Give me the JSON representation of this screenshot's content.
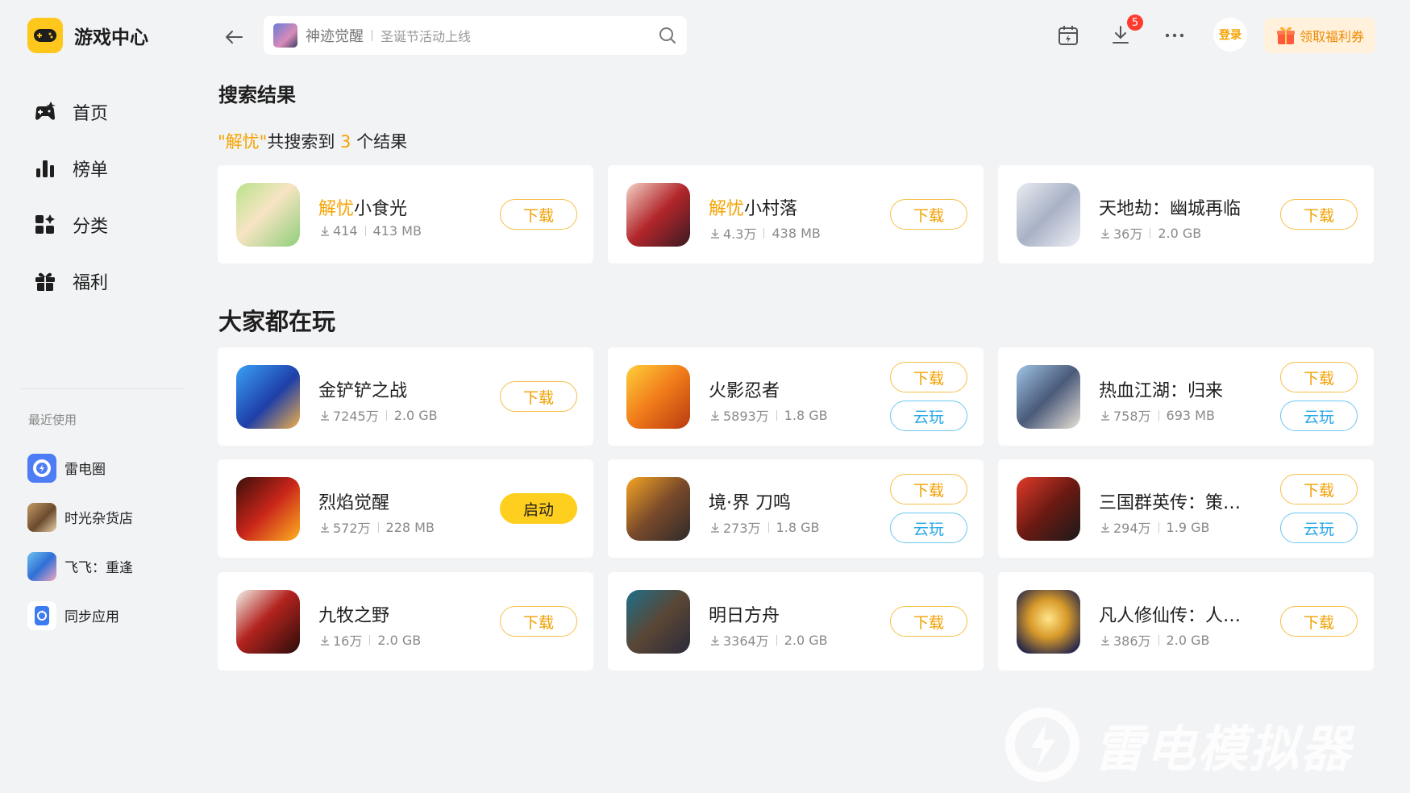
{
  "app": {
    "title": "游戏中心"
  },
  "sidebar": {
    "nav": [
      {
        "label": "首页",
        "icon": "gamepad-icon"
      },
      {
        "label": "榜单",
        "icon": "chart-icon"
      },
      {
        "label": "分类",
        "icon": "category-icon"
      },
      {
        "label": "福利",
        "icon": "gift-icon"
      }
    ],
    "recent_title": "最近使用",
    "recent": [
      {
        "label": "雷电圈",
        "icon": "leidian-circle-icon"
      },
      {
        "label": "时光杂货店",
        "icon": "app-thumbnail"
      },
      {
        "label": "飞飞：重逢",
        "icon": "app-thumbnail"
      },
      {
        "label": "同步应用",
        "icon": "sync-app-icon"
      }
    ]
  },
  "topbar": {
    "search_game": "神迹觉醒",
    "search_hint": "圣诞节活动上线",
    "download_badge": "5",
    "login_label": "登录",
    "coupon_label": "领取福利券"
  },
  "search_results": {
    "title": "搜索结果",
    "quote_open": "\"",
    "keyword": "解忧",
    "quote_close": "\"",
    "text_before": "共搜索到 ",
    "count": "3",
    "text_after": " 个结果",
    "items": [
      {
        "hl": "解忧",
        "rest": "小食光",
        "downloads": "414",
        "size": "413 MB",
        "buttons": [
          "下载"
        ]
      },
      {
        "hl": "解忧",
        "rest": "小村落",
        "downloads": "4.3万",
        "size": "438 MB",
        "buttons": [
          "下载"
        ]
      },
      {
        "hl": "",
        "rest": "天地劫：幽城再临",
        "downloads": "36万",
        "size": "2.0 GB",
        "buttons": [
          "下载"
        ]
      }
    ]
  },
  "popular": {
    "title": "大家都在玩",
    "items": [
      {
        "name": "金铲铲之战",
        "downloads": "7245万",
        "size": "2.0 GB",
        "buttons": [
          "下载"
        ]
      },
      {
        "name": "火影忍者",
        "downloads": "5893万",
        "size": "1.8 GB",
        "buttons": [
          "下载",
          "云玩"
        ]
      },
      {
        "name": "热血江湖：归来",
        "downloads": "758万",
        "size": "693 MB",
        "buttons": [
          "下载",
          "云玩"
        ]
      },
      {
        "name": "烈焰觉醒",
        "downloads": "572万",
        "size": "228 MB",
        "buttons": [
          "启动"
        ]
      },
      {
        "name": "境·界 刀鸣",
        "downloads": "273万",
        "size": "1.8 GB",
        "buttons": [
          "下载",
          "云玩"
        ]
      },
      {
        "name": "三国群英传：策定...",
        "downloads": "294万",
        "size": "1.9 GB",
        "buttons": [
          "下载",
          "云玩"
        ]
      },
      {
        "name": "九牧之野",
        "downloads": "16万",
        "size": "2.0 GB",
        "buttons": [
          "下载"
        ]
      },
      {
        "name": "明日方舟",
        "downloads": "3364万",
        "size": "2.0 GB",
        "buttons": [
          "下载"
        ]
      },
      {
        "name": "凡人修仙传：人界篇",
        "downloads": "386万",
        "size": "2.0 GB",
        "buttons": [
          "下载"
        ]
      }
    ]
  },
  "watermark": "雷电模拟器",
  "colors": {
    "accent": "#f5a300",
    "start_button": "#ffcf1f",
    "cloud": "#27a8e5",
    "badge": "#ff3b30"
  }
}
